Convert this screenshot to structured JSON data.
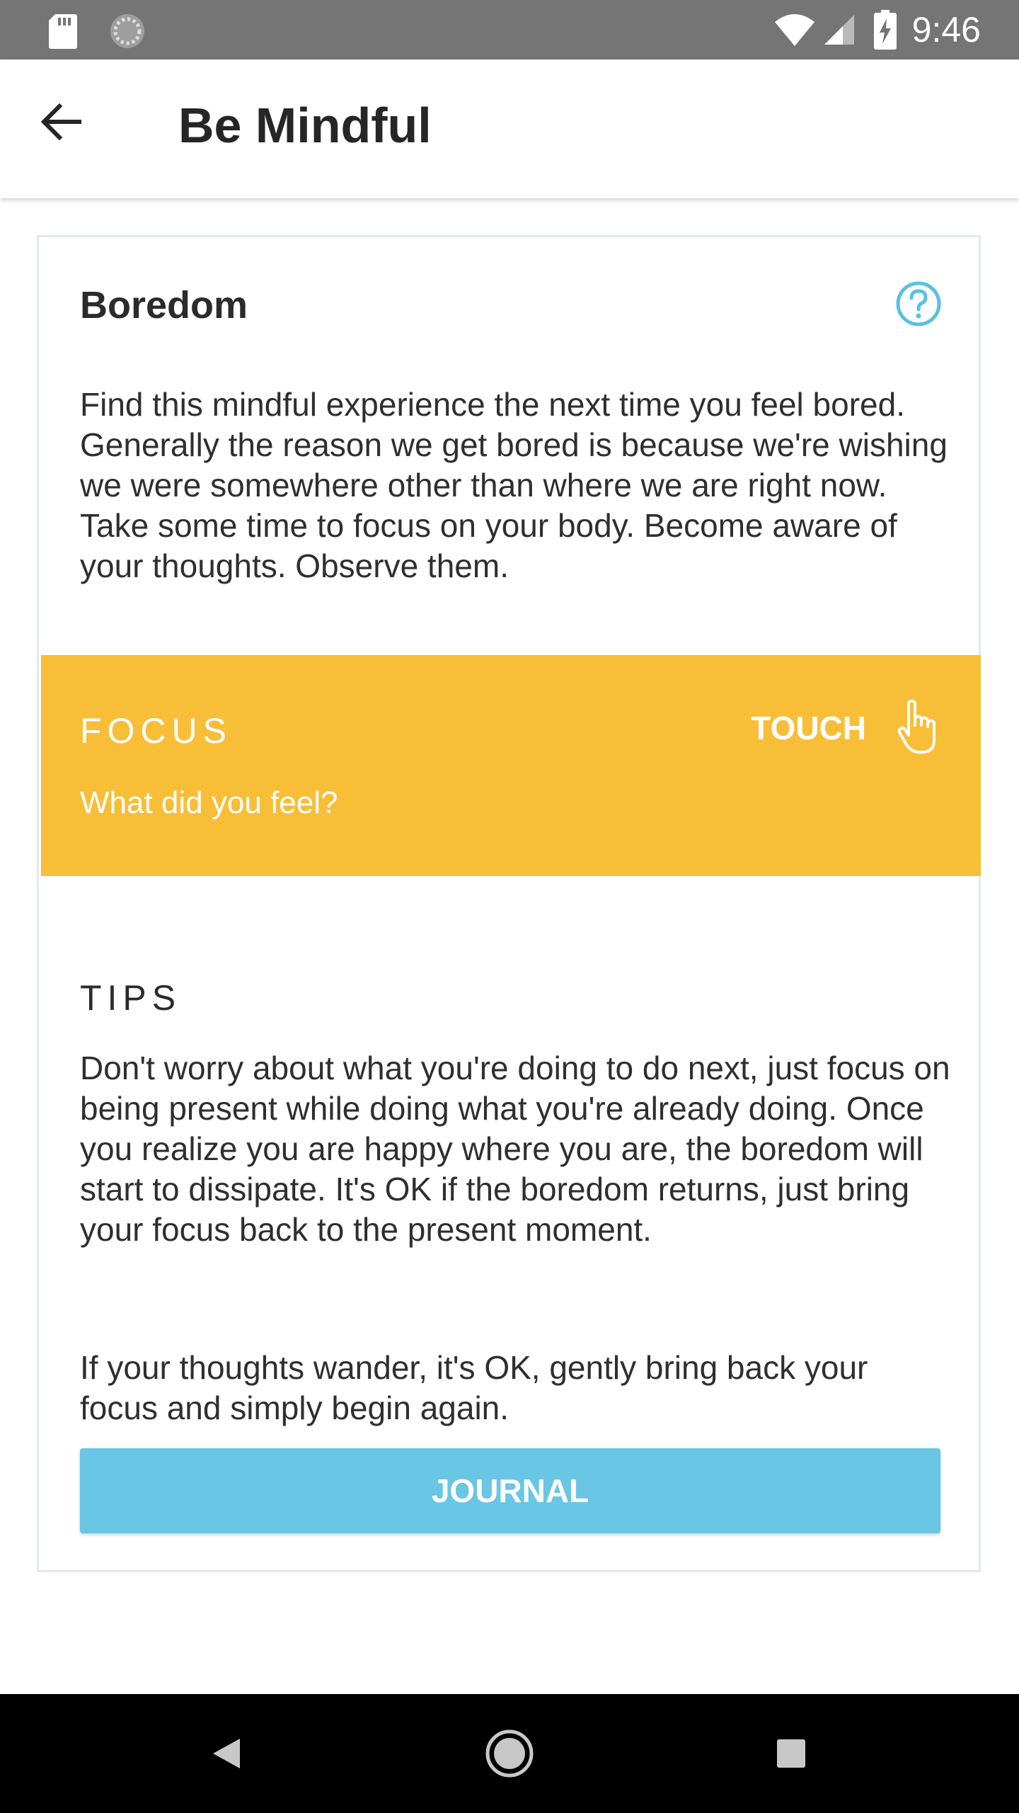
{
  "status_bar": {
    "time": "9:46",
    "icons": [
      "sd-card-icon",
      "sync-icon",
      "wifi-icon",
      "signal-icon",
      "battery-charging-icon"
    ]
  },
  "app_bar": {
    "title": "Be Mindful",
    "back_icon": "arrow-back-icon"
  },
  "card": {
    "title": "Boredom",
    "help_icon": "help-circle-icon",
    "description": "Find this mindful experience the next time you feel bored. Generally the reason we get bored is because we're wishing we were somewhere other than where we are right now. Take some time to focus on your body. Become aware of your thoughts. Observe them.",
    "focus": {
      "label": "FOCUS",
      "question": "What did you feel?",
      "touch_label": "TOUCH",
      "touch_icon": "pointing-hand-icon",
      "background": "#f8be38"
    },
    "tips": {
      "label": "TIPS",
      "paragraph1": "Don't worry about what you're doing to do next, just focus on being present while doing what you're already doing. Once you realize you are happy where you are, the boredom will start to dissipate. It's OK if the boredom returns, just bring your focus back to the present moment.",
      "paragraph2": "If your thoughts wander, it's OK, gently bring back your focus and simply begin again."
    },
    "journal_button": "JOURNAL",
    "journal_color": "#69c6e4"
  },
  "nav_bar": {
    "icons": [
      "back-triangle-icon",
      "home-circle-icon",
      "recents-square-icon"
    ]
  }
}
